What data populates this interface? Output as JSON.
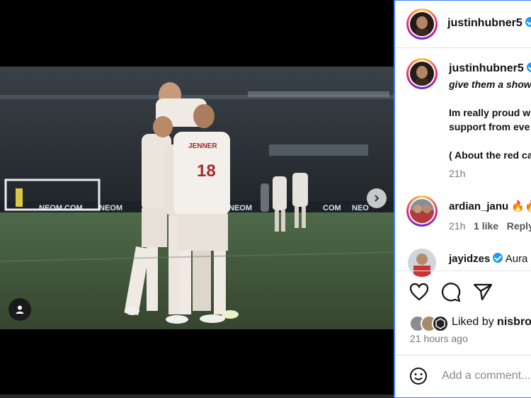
{
  "post": {
    "author": "justinhubner5",
    "verified": true
  },
  "caption": {
    "author": "justinhubner5",
    "line1": "give them a show",
    "line2": "Im really proud w",
    "line3": "support from eve",
    "line4": "( About the red ca",
    "time": "21h"
  },
  "comments": [
    {
      "user": "ardian_janu",
      "text": "🔥🔥",
      "time": "21h",
      "likes": "1 like",
      "reply": "Reply"
    },
    {
      "user": "jayidzes",
      "text": "Aura",
      "verified": true
    }
  ],
  "actions": {
    "like_icon": "heart-icon",
    "comment_icon": "comment-bubble-icon",
    "share_icon": "send-icon"
  },
  "likes": {
    "prefix": "Liked by",
    "user": "nisbro"
  },
  "timestamp": "21 hours ago",
  "add_comment_placeholder": "Add a comment...",
  "media": {
    "jersey_name": "JENNER",
    "jersey_number": "18",
    "boards": [
      "NEOM.COM",
      "NEOM",
      "NEOM",
      "COM",
      "NEO"
    ]
  },
  "colors": {
    "accent_border": "#3b82f6",
    "verified": "#1d9bf0",
    "text_primary": "#111111",
    "text_secondary": "#777777"
  }
}
